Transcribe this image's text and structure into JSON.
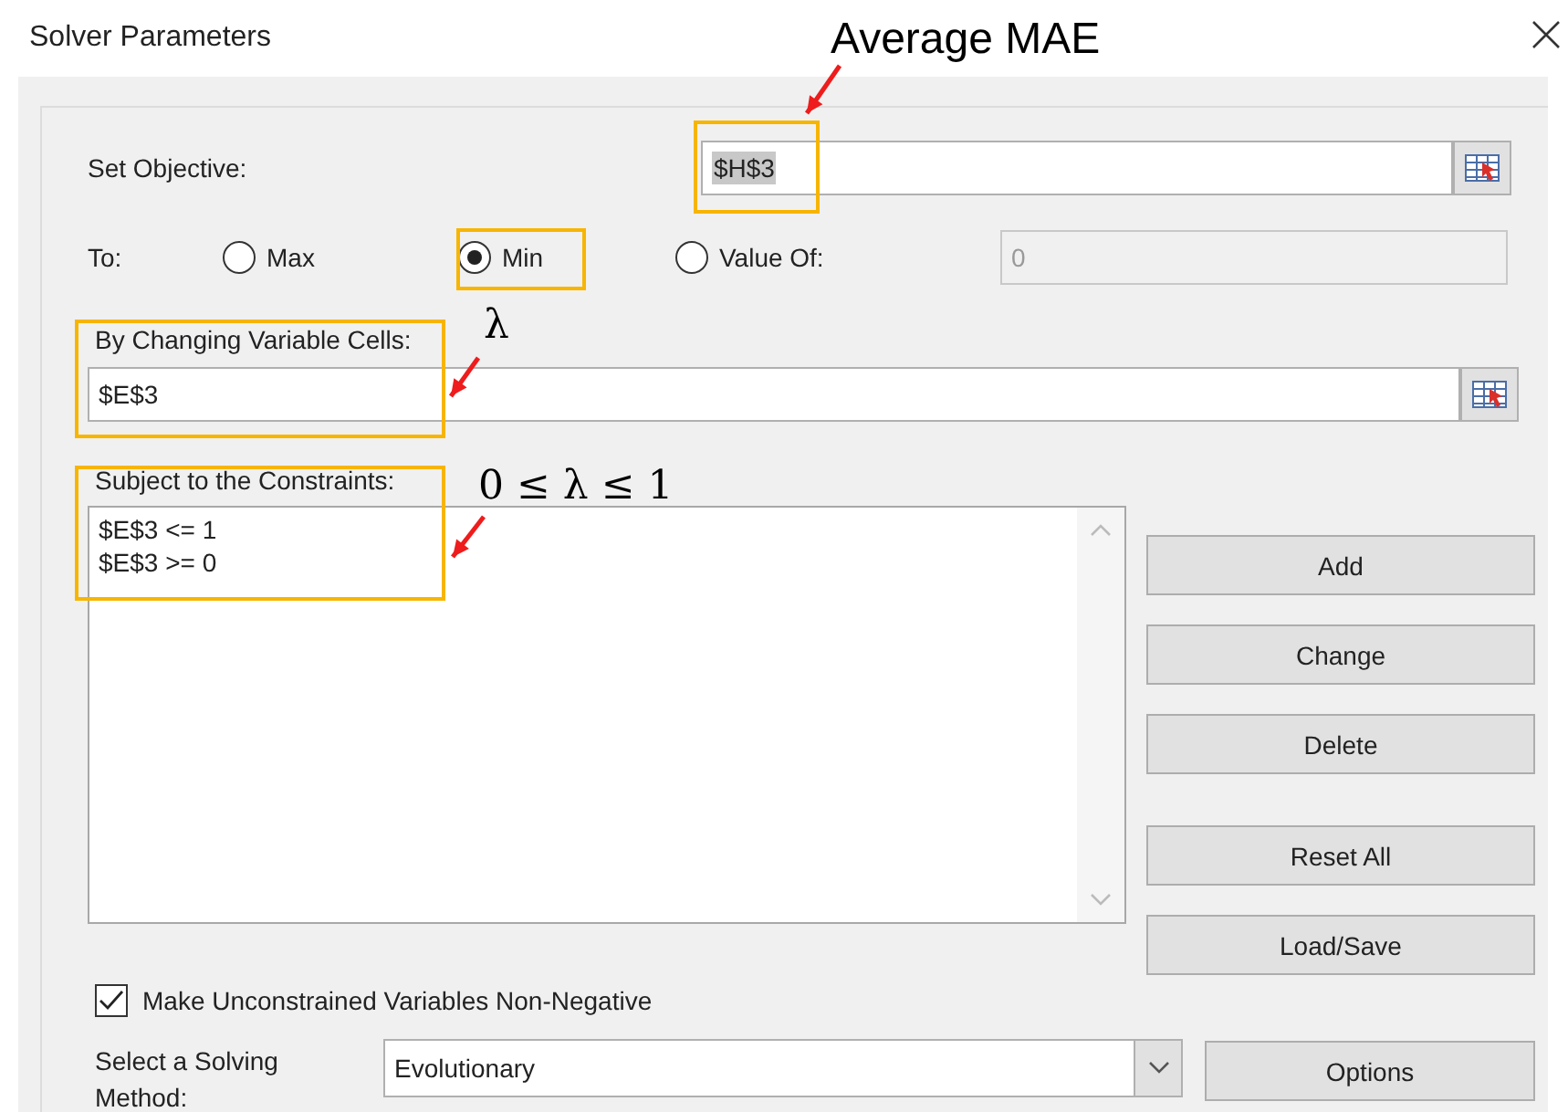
{
  "window": {
    "title": "Solver Parameters"
  },
  "objective": {
    "label": "Set Objective:",
    "value": "$H$3",
    "value_selected": true
  },
  "to": {
    "label": "To:",
    "options": [
      {
        "label": "Max",
        "selected": false
      },
      {
        "label": "Min",
        "selected": true
      },
      {
        "label": "Value Of:",
        "selected": false
      }
    ],
    "value_of": {
      "value": "0",
      "disabled": true
    }
  },
  "variable_cells": {
    "label": "By Changing Variable Cells:",
    "value": "$E$3"
  },
  "constraints": {
    "label": "Subject to the Constraints:",
    "items": [
      "$E$3 <= 1",
      "$E$3 >= 0"
    ]
  },
  "highlights": [
    {
      "kind": "objective"
    },
    {
      "kind": "option"
    },
    {
      "kind": "variables"
    },
    {
      "kind": "constraints"
    }
  ],
  "buttons": [
    "Add",
    "Change",
    "Delete",
    "Reset All",
    "Load/Save"
  ],
  "nonnegative": {
    "label": "Make Unconstrained Variables Non-Negative",
    "checked": true
  },
  "method": {
    "label": "Select a Solving Method:",
    "value": "Evolutionary"
  },
  "options_button": "Options",
  "annotations": [
    {
      "text": "Average MAE",
      "kind": "sans"
    },
    {
      "text": "λ",
      "kind": "math"
    },
    {
      "text": "0 ≤ λ ≤ 1",
      "kind": "math"
    }
  ]
}
